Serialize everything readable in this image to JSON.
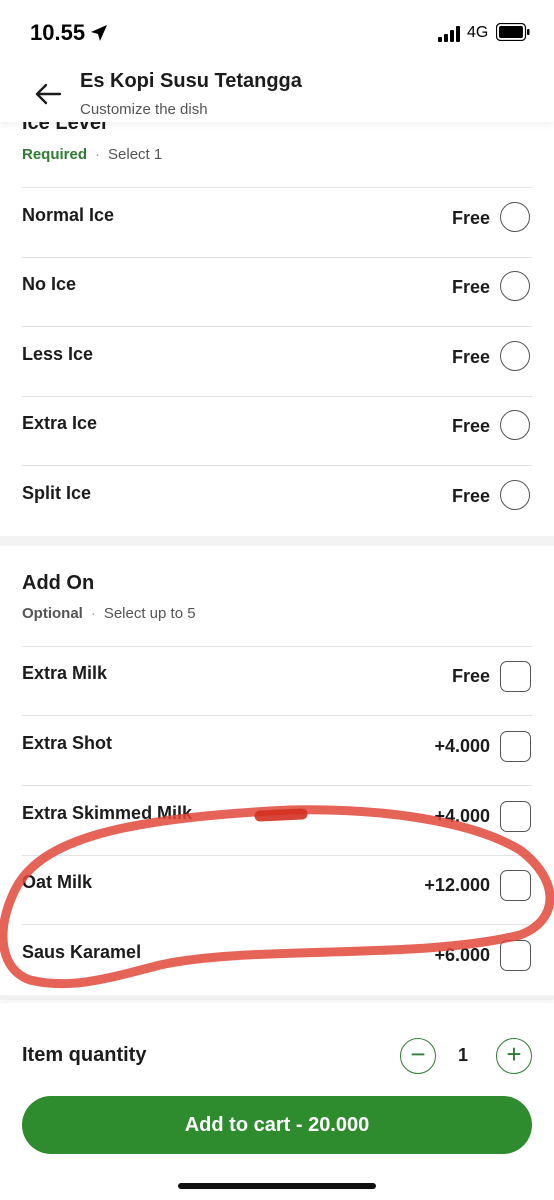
{
  "status": {
    "time": "10.55",
    "network": "4G",
    "icons": [
      "location-arrow-icon",
      "signal-bars-icon",
      "battery-icon"
    ]
  },
  "header": {
    "title": "Es Kopi Susu Tetangga",
    "subtitle": "Customize the dish",
    "back_icon": "back-arrow-icon"
  },
  "ice_section": {
    "title": "Ice Level",
    "requirement": "Required",
    "selection": "Select 1",
    "options": [
      {
        "label": "Normal Ice",
        "price": "Free"
      },
      {
        "label": "No Ice",
        "price": "Free"
      },
      {
        "label": "Less Ice",
        "price": "Free"
      },
      {
        "label": "Extra Ice",
        "price": "Free"
      },
      {
        "label": "Split Ice",
        "price": "Free"
      }
    ]
  },
  "addon_section": {
    "title": "Add On",
    "requirement": "Optional",
    "selection": "Select up to 5",
    "options": [
      {
        "label": "Extra Milk",
        "price": "Free"
      },
      {
        "label": "Extra Shot",
        "price": "+4.000"
      },
      {
        "label": "Extra Skimmed Milk",
        "price": "+4.000"
      },
      {
        "label": "Oat Milk",
        "price": "+12.000"
      },
      {
        "label": "Saus Karamel",
        "price": "+6.000"
      }
    ]
  },
  "footer": {
    "quantity_label": "Item quantity",
    "quantity": "1",
    "minus": "−",
    "plus": "+",
    "cart_button": "Add to cart - 20.000"
  },
  "colors": {
    "accent": "#2e7d32",
    "button": "#2e8b2e",
    "annotation": "#e0483a"
  }
}
